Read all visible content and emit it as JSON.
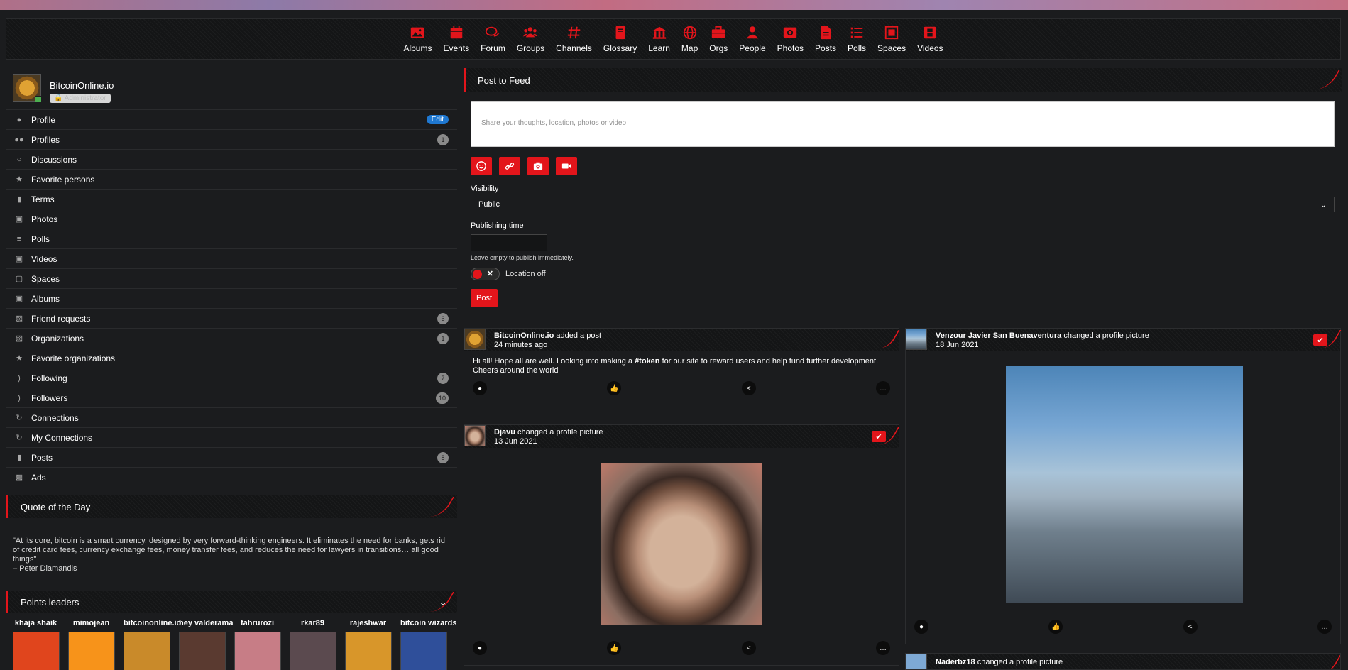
{
  "nav": [
    {
      "label": "Albums",
      "icon": "image-icon"
    },
    {
      "label": "Events",
      "icon": "calendar-icon"
    },
    {
      "label": "Forum",
      "icon": "comments-icon"
    },
    {
      "label": "Groups",
      "icon": "users-icon"
    },
    {
      "label": "Channels",
      "icon": "hashtag-icon"
    },
    {
      "label": "Glossary",
      "icon": "book-icon"
    },
    {
      "label": "Learn",
      "icon": "university-icon"
    },
    {
      "label": "Map",
      "icon": "globe-icon"
    },
    {
      "label": "Orgs",
      "icon": "briefcase-icon"
    },
    {
      "label": "People",
      "icon": "user-icon"
    },
    {
      "label": "Photos",
      "icon": "photo-icon"
    },
    {
      "label": "Posts",
      "icon": "file-icon"
    },
    {
      "label": "Polls",
      "icon": "list-icon"
    },
    {
      "label": "Spaces",
      "icon": "object-group-icon"
    },
    {
      "label": "Videos",
      "icon": "film-icon"
    }
  ],
  "profile": {
    "name": "BitcoinOnline.io",
    "role": "Administrator"
  },
  "sidebar_menu": [
    {
      "label": "Profile",
      "icon": "user-icon",
      "badge": "Edit",
      "badge_type": "edit"
    },
    {
      "label": "Profiles",
      "icon": "users-icon",
      "badge": "1"
    },
    {
      "label": "Discussions",
      "icon": "comments-icon",
      "badge": ""
    },
    {
      "label": "Favorite persons",
      "icon": "star-icon",
      "badge": ""
    },
    {
      "label": "Terms",
      "icon": "book-icon",
      "badge": ""
    },
    {
      "label": "Photos",
      "icon": "photo-icon",
      "badge": ""
    },
    {
      "label": "Polls",
      "icon": "list-icon",
      "badge": ""
    },
    {
      "label": "Videos",
      "icon": "film-icon",
      "badge": ""
    },
    {
      "label": "Spaces",
      "icon": "object-group-icon",
      "badge": ""
    },
    {
      "label": "Albums",
      "icon": "image-icon",
      "badge": ""
    },
    {
      "label": "Friend requests",
      "icon": "briefcase-icon",
      "badge": "6"
    },
    {
      "label": "Organizations",
      "icon": "briefcase-icon",
      "badge": "1"
    },
    {
      "label": "Favorite organizations",
      "icon": "star-icon",
      "badge": ""
    },
    {
      "label": "Following",
      "icon": "rss-icon",
      "badge": "7"
    },
    {
      "label": "Followers",
      "icon": "rss-icon",
      "badge": "10"
    },
    {
      "label": "Connections",
      "icon": "refresh-icon",
      "badge": ""
    },
    {
      "label": "My Connections",
      "icon": "refresh-icon",
      "badge": ""
    },
    {
      "label": "Posts",
      "icon": "file-icon",
      "badge": "8"
    },
    {
      "label": "Ads",
      "icon": "ad-icon",
      "badge": ""
    }
  ],
  "quote": {
    "title": "Quote of the Day",
    "text": "\"At its core, bitcoin is a smart currency, designed by very forward-thinking engineers. It eliminates the need for banks, gets rid of credit card fees, currency exchange fees, money transfer fees, and reduces the need for lawyers in transitions… all good things\"",
    "author": "– Peter Diamandis"
  },
  "leaders": {
    "title": "Points leaders",
    "items": [
      {
        "name": "khaja shaik",
        "color": "#e0451d"
      },
      {
        "name": "mimojean",
        "color": "#f7931a"
      },
      {
        "name": "bitcoinonline.io",
        "color": "#c98a2a"
      },
      {
        "name": "hey valderama",
        "color": "#5a3a30"
      },
      {
        "name": "fahrurozi",
        "color": "#c77d86"
      },
      {
        "name": "rkar89",
        "color": "#5b4a4f"
      },
      {
        "name": "rajeshwar",
        "color": "#d8962a"
      },
      {
        "name": "bitcoin wizards",
        "color": "#2f4f9a"
      }
    ]
  },
  "composer": {
    "title": "Post to Feed",
    "placeholder": "Share your thoughts, location, photos or video",
    "visibility_label": "Visibility",
    "visibility_value": "Public",
    "publishing_label": "Publishing time",
    "publishing_hint": "Leave empty to publish immediately.",
    "location_label": "Location off",
    "post_label": "Post"
  },
  "feed": [
    {
      "user": "BitcoinOnline.io",
      "action": "added a post",
      "time": "24 minutes ago",
      "text_before": "Hi all! Hope all are well. Looking into making a ",
      "hashtag": "#token",
      "text_after": " for our site to reward users and help fund further development. Cheers around the world"
    },
    {
      "user": "Djavu",
      "action": "changed a profile picture",
      "time": "13 Jun 2021"
    },
    {
      "user": "Venzour Javier San Buenaventura",
      "action": "changed a profile picture",
      "time": "18 Jun 2021"
    },
    {
      "user": "Naderbz18",
      "action": "changed a profile picture",
      "time": ""
    }
  ]
}
